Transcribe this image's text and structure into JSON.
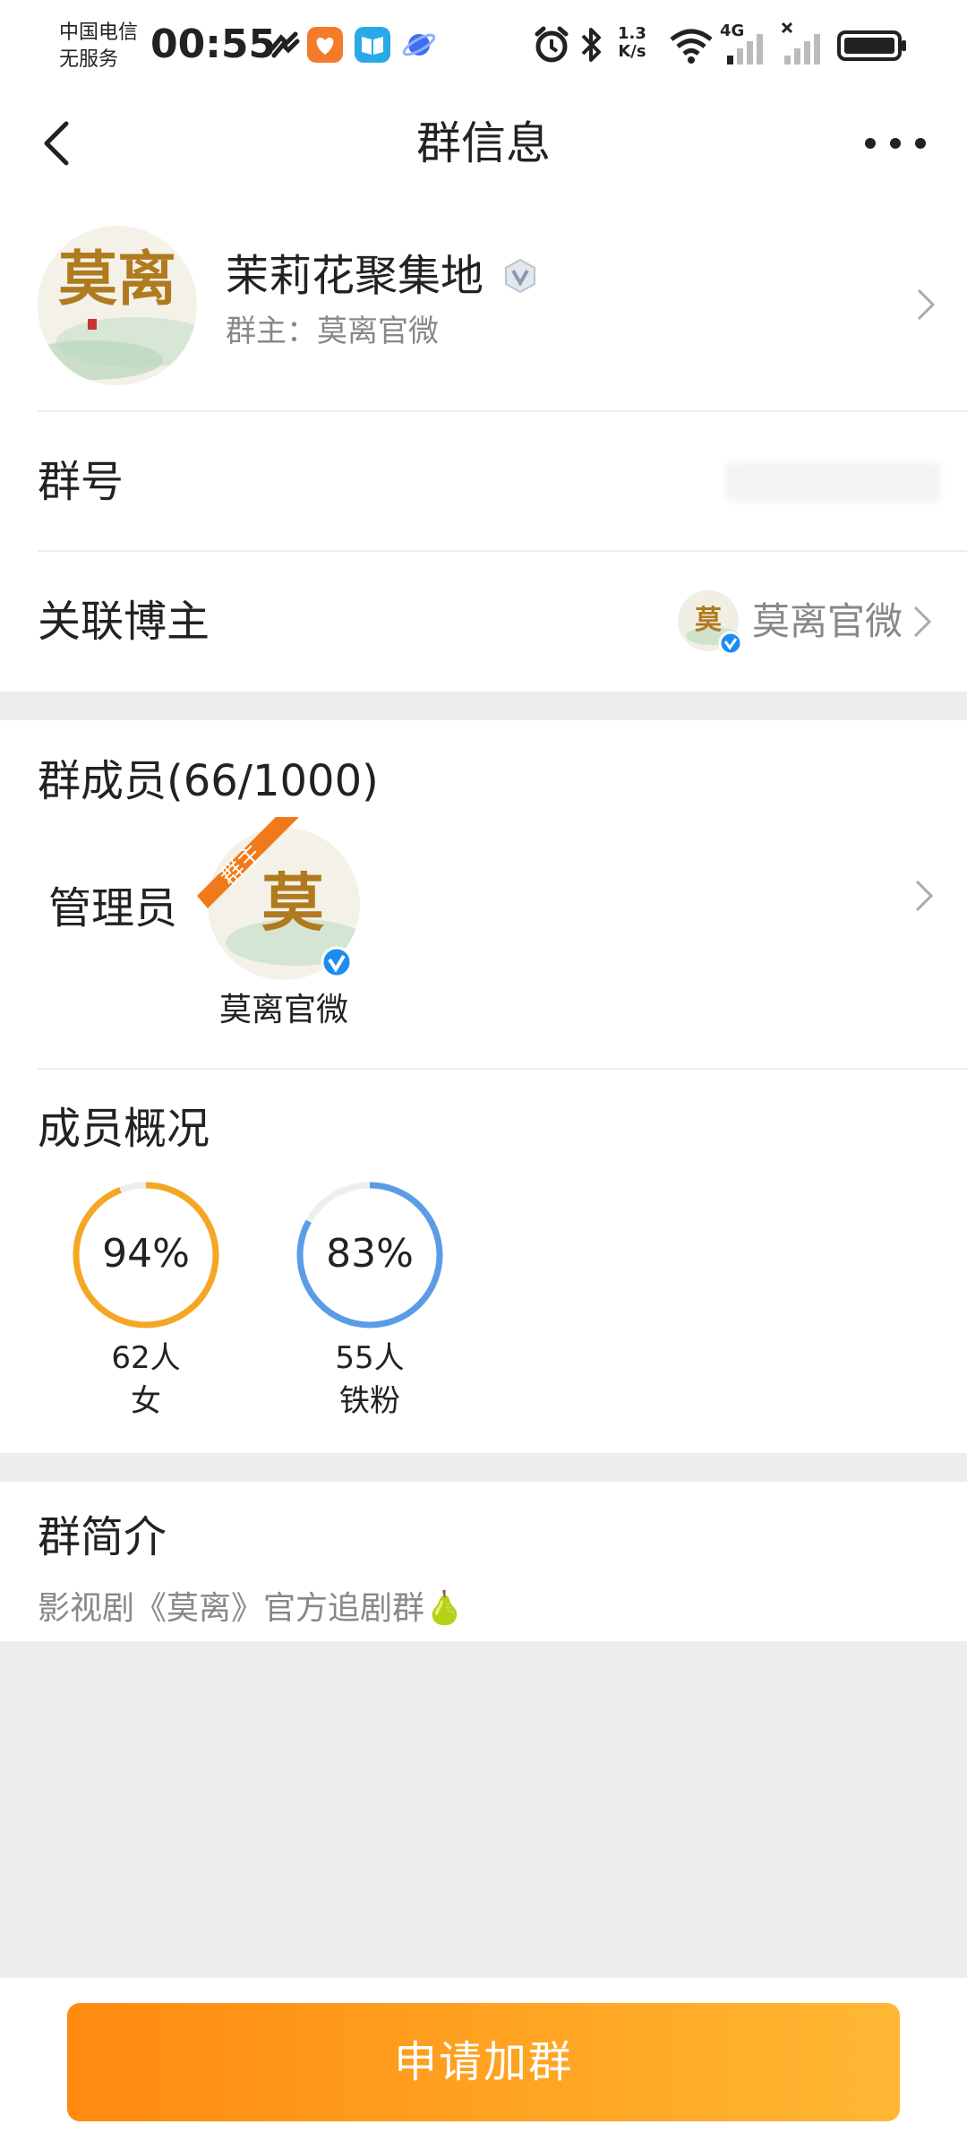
{
  "status_bar": {
    "carrier_line1": "中国电信",
    "carrier_line2": "无服务",
    "time": "00:55",
    "speed_value": "1.3",
    "speed_unit": "K/s",
    "network": "4G"
  },
  "nav": {
    "title": "群信息"
  },
  "group": {
    "name": "茉莉花聚集地",
    "owner_text": "群主：莫离官微",
    "avatar_text": "莫离"
  },
  "rows": {
    "group_number_label": "群号",
    "linked_blogger_label": "关联博主",
    "linked_blogger_name": "莫离官微"
  },
  "members": {
    "title": "群成员(66/1000)",
    "admin_label": "管理员",
    "admin_badge": "群主",
    "admin_name": "莫离官微"
  },
  "overview": {
    "title": "成员概况",
    "stats": [
      {
        "percent_text": "94%",
        "percent": 94,
        "count": "62人",
        "label": "女",
        "color": "#f5a623"
      },
      {
        "percent_text": "83%",
        "percent": 83,
        "count": "55人",
        "label": "铁粉",
        "color": "#5b9ce6"
      }
    ]
  },
  "intro": {
    "title": "群简介",
    "text": "影视剧《莫离》官方追剧群🍐"
  },
  "bottom": {
    "join_label": "申请加群"
  },
  "colors": {
    "accent_orange": "#ff8a10",
    "verified_blue": "#1d8cf0"
  }
}
